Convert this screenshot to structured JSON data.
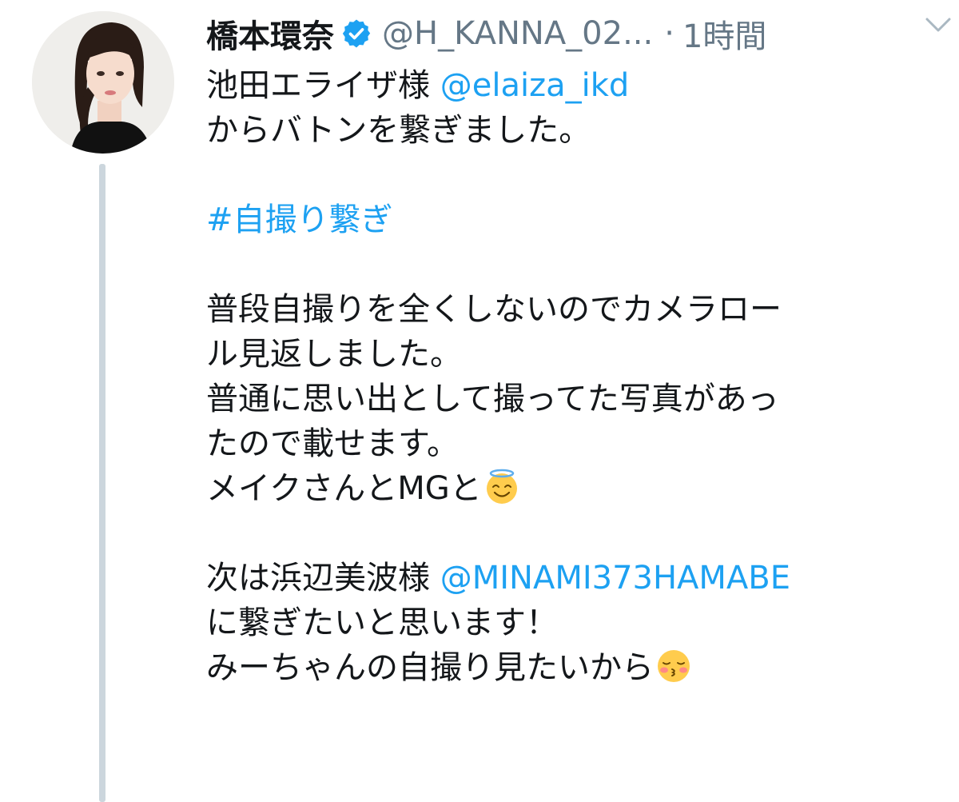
{
  "tweet": {
    "author": {
      "display_name": "橋本環奈",
      "verified_icon": "verified-badge-icon",
      "handle": "@H_KANNA_02...",
      "avatar_icon": "profile-photo"
    },
    "separator": "·",
    "time": "1時間",
    "menu_icon": "chevron-down-icon",
    "body": {
      "l1_text": "池田エライザ様 ",
      "l1_mention": "@elaiza_ikd",
      "l2": "からバトンを繋ぎました。",
      "hashtag": "#自撮り繋ぎ",
      "l4": "普段自撮りを全くしないのでカメラロー",
      "l5": "ル見返しました。",
      "l6": "普通に思い出として撮ってた写真があっ",
      "l7": "たので載せます。",
      "l8": "メイクさんとMGと",
      "l8_emoji": "smiling-face-with-halo-emoji",
      "l9_text": "次は浜辺美波様 ",
      "l9_mention": "@MINAMI373HAMABE",
      "l10": "に繋ぎたいと思います！",
      "l11": "みーちゃんの自撮り見たいから",
      "l11_emoji": "kissing-face-with-closed-eyes-emoji"
    }
  },
  "colors": {
    "link": "#1da1f2",
    "secondary_text": "#657786",
    "primary_text": "#14171a",
    "thread_line": "#ccd6dd",
    "verified": "#1da1f2"
  }
}
